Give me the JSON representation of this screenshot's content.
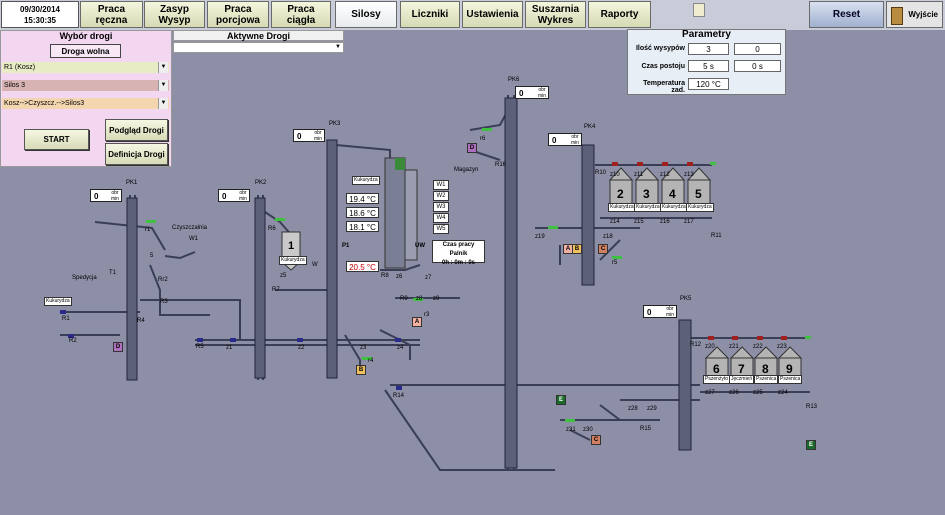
{
  "header": {
    "date": "09/30/2014",
    "time": "15:30:35",
    "tabs": [
      "Praca ręczna",
      "Zasyp Wysyp",
      "Praca porcjowa",
      "Praca ciągła",
      "Silosy",
      "Liczniki",
      "Ustawienia",
      "Suszarnia Wykres",
      "Raporty"
    ],
    "active_tab": "Silosy",
    "reset_label": "Reset",
    "exit_label": "Wyjście"
  },
  "route_panel": {
    "title": "Wybór drogi",
    "status": "Droga wolna",
    "selects": [
      "R1 (Kosz)",
      "Silos 3",
      "Kosz-->Czyszcz.-->Silos3"
    ],
    "start_label": "START",
    "preview_label": "Podgląd Drogi",
    "define_label": "Definicja Drogi"
  },
  "active_routes": {
    "title": "Aktywne Drogi"
  },
  "params": {
    "title": "Parametry",
    "rows": [
      {
        "label": "Ilość wysypów",
        "value": "3",
        "value2": "0"
      },
      {
        "label": "Czas postoju",
        "value": "5 s",
        "value2": "0 s"
      },
      {
        "label": "Temperatura zad.",
        "value": "120 °C"
      }
    ]
  },
  "elevators": [
    {
      "id": "PK1",
      "rpm": "0"
    },
    {
      "id": "PK2",
      "rpm": "0"
    },
    {
      "id": "PK3",
      "rpm": "0"
    },
    {
      "id": "PK6",
      "rpm": "0"
    },
    {
      "id": "PK4",
      "rpm": "0"
    },
    {
      "id": "PK5",
      "rpm": "0"
    }
  ],
  "rpm_unit_top": "obr",
  "rpm_unit_bottom": "min",
  "dryer": {
    "temps": [
      "19.4 °C",
      "18.6 °C",
      "18.1 °C",
      "20.5 °C"
    ],
    "levels": [
      "W1",
      "W2",
      "W3",
      "W4",
      "W5"
    ],
    "burner_title": "Czas pracy Palnik",
    "burner_time": "0h : 0m : 0s",
    "labels": [
      "P1",
      "UW"
    ]
  },
  "labels": {
    "cleaner": "Czyszczalnia",
    "shipping": "Spedycja",
    "warehouse": "Magazyn",
    "corn": "Kukurydza"
  },
  "silos_a": [
    {
      "n": "2",
      "tag": "Kukurydza"
    },
    {
      "n": "3",
      "tag": "Kukurydza"
    },
    {
      "n": "4",
      "tag": "Kukurydza"
    },
    {
      "n": "5",
      "tag": "Kukurydza"
    }
  ],
  "silos_b": [
    {
      "n": "6",
      "tag": "Pszenżyto"
    },
    {
      "n": "7",
      "tag": "Jęczmień"
    },
    {
      "n": "8",
      "tag": "Pszenica"
    },
    {
      "n": "9",
      "tag": "Pszenica"
    }
  ],
  "silo1": {
    "n": "1",
    "tag": "Kukurydza"
  },
  "component_labels": [
    "R1",
    "R2",
    "T1",
    "R4",
    "R3",
    "R5",
    "z1",
    "R6",
    "R7",
    "z5",
    "W",
    "W1",
    "r1",
    "Rr2",
    "5",
    "z2",
    "R8",
    "z6",
    "z7",
    "R9",
    "z8",
    "z9",
    "r3",
    "z3",
    "r4",
    "z4",
    "R14",
    "r6",
    "R16",
    "R10",
    "z10",
    "z11",
    "z12",
    "z13",
    "z14",
    "z15",
    "z16",
    "z17",
    "R11",
    "z18",
    "z19",
    "r5",
    "R12",
    "z20",
    "z21",
    "z22",
    "z23",
    "z24",
    "z25",
    "z26",
    "z27",
    "z28",
    "z29",
    "R13",
    "z30",
    "z31",
    "R15"
  ],
  "badges": [
    "D",
    "D",
    "A",
    "B",
    "E",
    "A",
    "B",
    "C",
    "C",
    "E"
  ],
  "colors": {
    "background": "#8c8fa6",
    "pipe": "#3b3f55",
    "elevator": "#5c6078",
    "green": "#40c040",
    "panel_pink": "#f3d6f0"
  }
}
